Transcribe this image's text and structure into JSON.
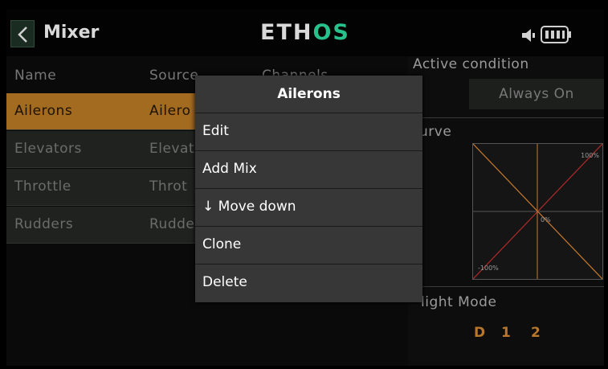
{
  "header": {
    "title": "Mixer",
    "logo_part1": "ETH",
    "logo_part2": "OS",
    "icons": [
      "back-chevron-icon",
      "speaker-icon",
      "battery-icon"
    ]
  },
  "table": {
    "columns": [
      "Name",
      "Source",
      "Channels"
    ],
    "rows": [
      {
        "name": "Ailerons",
        "source": "Ailero",
        "selected": true
      },
      {
        "name": "Elevators",
        "source": "Elevat",
        "selected": false
      },
      {
        "name": "Throttle",
        "source": "Throt",
        "selected": false
      },
      {
        "name": "Rudders",
        "source": "Rudde",
        "selected": false
      }
    ]
  },
  "details": {
    "active_condition_label": "Active condition",
    "active_condition_value": "Always On",
    "curve_label": "urve",
    "curve_labels": {
      "top": "100%",
      "mid": "0%",
      "bottom": "-100%"
    },
    "flight_mode_label": "light Mode",
    "flight_modes": [
      "D",
      "1",
      "2"
    ]
  },
  "popup": {
    "title": "Ailerons",
    "items": [
      "Edit",
      "Add Mix",
      "↓ Move down",
      "Clone",
      "Delete"
    ]
  },
  "colors": {
    "accent_orange": "#a36b1f",
    "logo_green": "#28c08b",
    "curve_orange": "#c77a2a",
    "curve_red": "#b02a2a"
  }
}
